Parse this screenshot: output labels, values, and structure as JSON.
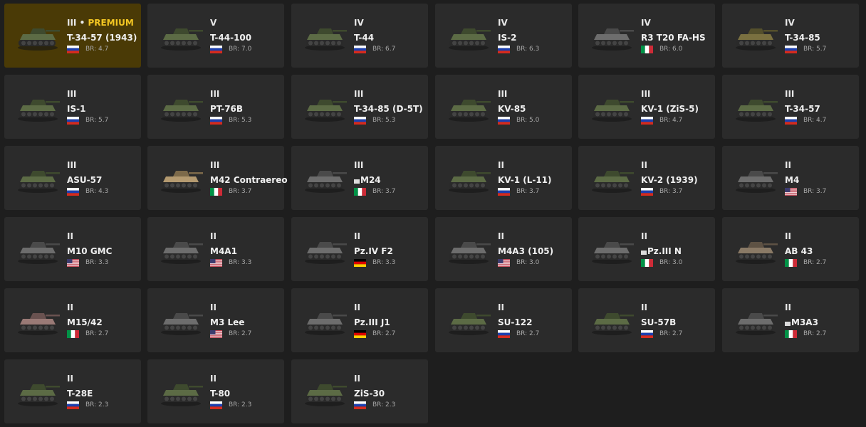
{
  "colors": {
    "background": "#1e1e1e",
    "card": "#2b2b2b",
    "premium_card": "#4a3a06",
    "premium_text": "#f3c623"
  },
  "vehicles": [
    {
      "rank": "III",
      "premium_label": "PREMIUM",
      "name": "T-34-57 (1943)",
      "nation": "ussr",
      "br": "BR: 4.7",
      "premium": true,
      "camo": "green"
    },
    {
      "rank": "V",
      "name": "T-44-100",
      "nation": "ussr",
      "br": "BR: 7.0",
      "camo": "green"
    },
    {
      "rank": "IV",
      "name": "T-44",
      "nation": "ussr",
      "br": "BR: 6.7",
      "camo": "green"
    },
    {
      "rank": "IV",
      "name": "IS-2",
      "nation": "ussr",
      "br": "BR: 6.3",
      "camo": "green"
    },
    {
      "rank": "IV",
      "name": "R3 T20 FA-HS",
      "nation": "italy",
      "br": "BR: 6.0",
      "camo": "gray"
    },
    {
      "rank": "IV",
      "name": "T-34-85",
      "nation": "ussr",
      "br": "BR: 5.7",
      "camo": "olive"
    },
    {
      "rank": "III",
      "name": "IS-1",
      "nation": "ussr",
      "br": "BR: 5.7",
      "camo": "green"
    },
    {
      "rank": "III",
      "name": "PT-76B",
      "nation": "ussr",
      "br": "BR: 5.3",
      "camo": "green"
    },
    {
      "rank": "III",
      "name": "T-34-85 (D-5T)",
      "nation": "ussr",
      "br": "BR: 5.3",
      "camo": "green"
    },
    {
      "rank": "III",
      "name": "KV-85",
      "nation": "ussr",
      "br": "BR: 5.0",
      "camo": "green"
    },
    {
      "rank": "III",
      "name": "KV-1 (ZiS-5)",
      "nation": "ussr",
      "br": "BR: 4.7",
      "camo": "green"
    },
    {
      "rank": "III",
      "name": "T-34-57",
      "nation": "ussr",
      "br": "BR: 4.7",
      "camo": "green"
    },
    {
      "rank": "III",
      "name": "ASU-57",
      "nation": "ussr",
      "br": "BR: 4.3",
      "camo": "green"
    },
    {
      "rank": "III",
      "name": "M42 Contraereo",
      "nation": "italy",
      "br": "BR: 3.7",
      "camo": "sand"
    },
    {
      "rank": "III",
      "name": "M24",
      "nation": "italy",
      "br": "BR: 3.7",
      "camo": "gray",
      "name_icon": true
    },
    {
      "rank": "II",
      "name": "KV-1 (L-11)",
      "nation": "ussr",
      "br": "BR: 3.7",
      "camo": "green"
    },
    {
      "rank": "II",
      "name": "KV-2 (1939)",
      "nation": "ussr",
      "br": "BR: 3.7",
      "camo": "green"
    },
    {
      "rank": "II",
      "name": "M4",
      "nation": "usa",
      "br": "BR: 3.7",
      "camo": "gray"
    },
    {
      "rank": "II",
      "name": "M10 GMC",
      "nation": "usa",
      "br": "BR: 3.3",
      "camo": "gray"
    },
    {
      "rank": "II",
      "name": "M4A1",
      "nation": "usa",
      "br": "BR: 3.3",
      "camo": "gray"
    },
    {
      "rank": "II",
      "name": "Pz.IV F2",
      "nation": "germany",
      "br": "BR: 3.3",
      "camo": "gray"
    },
    {
      "rank": "II",
      "name": "M4A3 (105)",
      "nation": "usa",
      "br": "BR: 3.0",
      "camo": "gray"
    },
    {
      "rank": "II",
      "name": "Pz.III N",
      "nation": "italy",
      "br": "BR: 3.0",
      "camo": "gray",
      "name_icon": true
    },
    {
      "rank": "II",
      "name": "AB 43",
      "nation": "italy",
      "br": "BR: 2.7",
      "camo": "tan"
    },
    {
      "rank": "II",
      "name": "M15/42",
      "nation": "italy",
      "br": "BR: 2.7",
      "camo": "pink"
    },
    {
      "rank": "II",
      "name": "M3 Lee",
      "nation": "usa",
      "br": "BR: 2.7",
      "camo": "gray"
    },
    {
      "rank": "II",
      "name": "Pz.III J1",
      "nation": "germany",
      "br": "BR: 2.7",
      "camo": "gray"
    },
    {
      "rank": "II",
      "name": "SU-122",
      "nation": "ussr",
      "br": "BR: 2.7",
      "camo": "green"
    },
    {
      "rank": "II",
      "name": "SU-57B",
      "nation": "ussr",
      "br": "BR: 2.7",
      "camo": "green"
    },
    {
      "rank": "II",
      "name": "M3A3",
      "nation": "italy",
      "br": "BR: 2.7",
      "camo": "gray",
      "name_icon": true
    },
    {
      "rank": "II",
      "name": "T-28E",
      "nation": "ussr",
      "br": "BR: 2.3",
      "camo": "green"
    },
    {
      "rank": "II",
      "name": "T-80",
      "nation": "ussr",
      "br": "BR: 2.3",
      "camo": "green"
    },
    {
      "rank": "II",
      "name": "ZiS-30",
      "nation": "ussr",
      "br": "BR: 2.3",
      "camo": "green"
    }
  ]
}
